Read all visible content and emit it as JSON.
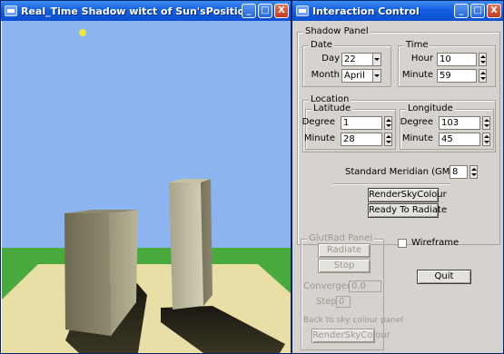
{
  "left_window": {
    "title": "Real_Time Shadow witct of Sun'sPosition",
    "buttons": {
      "minimize": "_",
      "maximize": "□",
      "close": "X"
    },
    "colors": {
      "sky": "#8cb4f0",
      "ground": "#48aa3c",
      "floor": "#e8dea6",
      "sun": "#f0e63a"
    }
  },
  "right_window": {
    "title": "Interaction Control",
    "buttons": {
      "minimize": "_",
      "maximize": "□",
      "close": "X"
    },
    "shadow_panel": {
      "label": "Shadow Panel",
      "date": {
        "label": "Date",
        "day_label": "Day",
        "day_value": "22",
        "month_label": "Month",
        "month_value": "April"
      },
      "time": {
        "label": "Time",
        "hour_label": "Hour",
        "hour_value": "10",
        "minute_label": "Minute",
        "minute_value": "59"
      },
      "location": {
        "label": "Location",
        "latitude": {
          "label": "Latitude",
          "degree_label": "Degree",
          "degree_value": "1",
          "minute_label": "Minute",
          "minute_value": "28"
        },
        "longitude": {
          "label": "Longitude",
          "degree_label": "Degree",
          "degree_value": "103",
          "minute_label": "Minute",
          "minute_value": "45"
        }
      },
      "meridian_label": "Standard Meridian (GMT)",
      "meridian_value": "8",
      "render_sky_button": "RenderSkyColour",
      "ready_button": "Ready To Radiate"
    },
    "glutrad_panel": {
      "label": "GlutRad Panel",
      "radiate_button": "Radiate",
      "stop_button": "Stop",
      "convergence_label": "Convergence",
      "convergence_value": "0.0",
      "step_label": "Step",
      "step_value": "0",
      "back_label": "Back to sky colour panel",
      "render_sky_button": "RenderSkyColour"
    },
    "wireframe_label": "Wireframe",
    "quit_button": "Quit"
  }
}
